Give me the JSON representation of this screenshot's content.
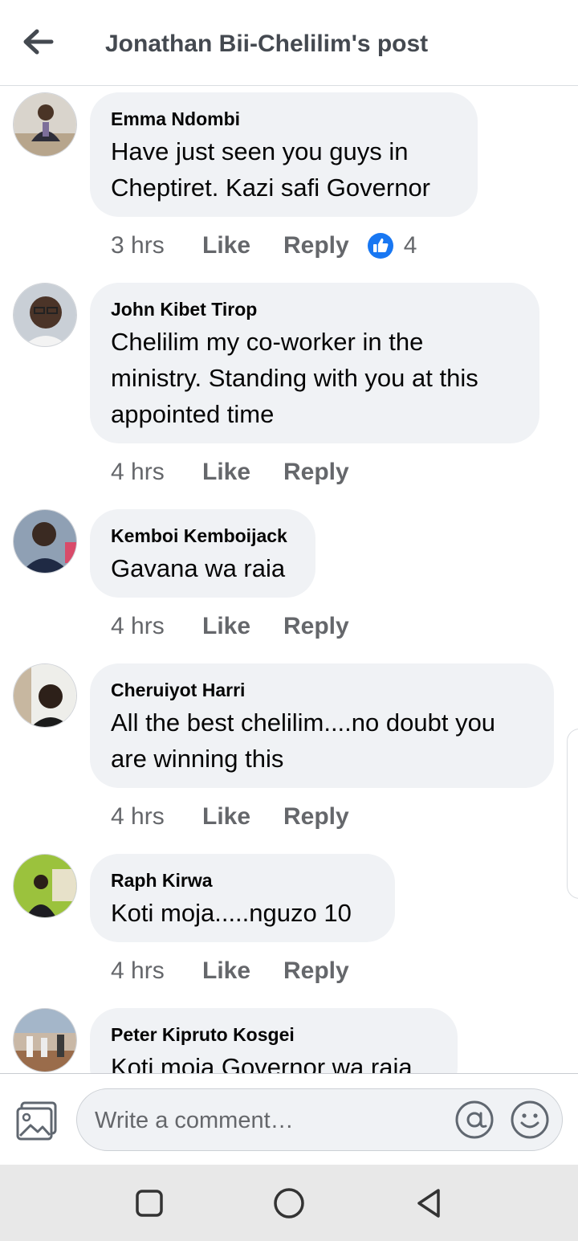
{
  "header": {
    "title": "Jonathan Bii-Chelilim's post",
    "back_icon": "arrow-left-icon"
  },
  "comments": [
    {
      "author": "Emma Ndombi",
      "text": "Have just seen you guys in Cheptiret. Kazi safi Governor",
      "time": "3 hrs",
      "like_label": "Like",
      "reply_label": "Reply",
      "reaction_icon": "thumbs-up-icon",
      "reaction_count": "4"
    },
    {
      "author": "John Kibet Tirop",
      "text": "Chelilim my co-worker in the ministry. Standing with you at this appointed time",
      "time": "4 hrs",
      "like_label": "Like",
      "reply_label": "Reply"
    },
    {
      "author": "Kemboi Kemboijack",
      "text": "Gavana wa raia",
      "time": "4 hrs",
      "like_label": "Like",
      "reply_label": "Reply"
    },
    {
      "author": "Cheruiyot Harri",
      "text": "All the best chelilim....no doubt you are winning this",
      "time": "4 hrs",
      "like_label": "Like",
      "reply_label": "Reply"
    },
    {
      "author": "Raph Kirwa",
      "text": "Koti moja.....nguzo 10",
      "time": "4 hrs",
      "like_label": "Like",
      "reply_label": "Reply"
    },
    {
      "author": "Peter Kipruto Kosgei",
      "text": "Koti moja Governor wa raia"
    }
  ],
  "composer": {
    "placeholder": "Write a comment…",
    "photo_icon": "photo-icon",
    "mention_icon": "at-sign-icon",
    "emoji_icon": "emoji-icon"
  },
  "colors": {
    "accent": "#1877f2",
    "bubble": "#f0f2f5",
    "secondary_text": "#65676b"
  },
  "system_nav": [
    "recent-apps-icon",
    "home-icon",
    "back-icon"
  ]
}
